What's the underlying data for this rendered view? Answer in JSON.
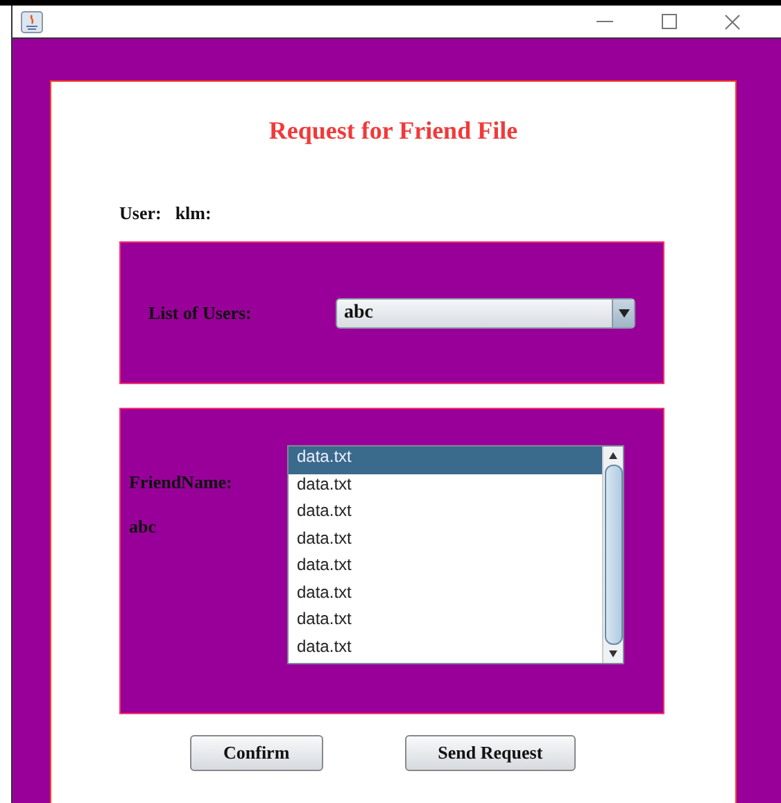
{
  "form": {
    "title": "Request for Friend File",
    "user_label": "User:",
    "user_value": "klm:"
  },
  "users_panel": {
    "label": "List of Users:",
    "dropdown": {
      "value": "abc"
    }
  },
  "friend_panel": {
    "label": "FriendName:",
    "value": "abc",
    "files": [
      {
        "name": "data.txt",
        "selected": true
      },
      {
        "name": "data.txt",
        "selected": false
      },
      {
        "name": "data.txt",
        "selected": false
      },
      {
        "name": "data.txt",
        "selected": false
      },
      {
        "name": "data.txt",
        "selected": false
      },
      {
        "name": "data.txt",
        "selected": false
      },
      {
        "name": "data.txt",
        "selected": false
      },
      {
        "name": "data.txt",
        "selected": false
      }
    ]
  },
  "buttons": [
    "Confirm",
    "Send Request"
  ]
}
